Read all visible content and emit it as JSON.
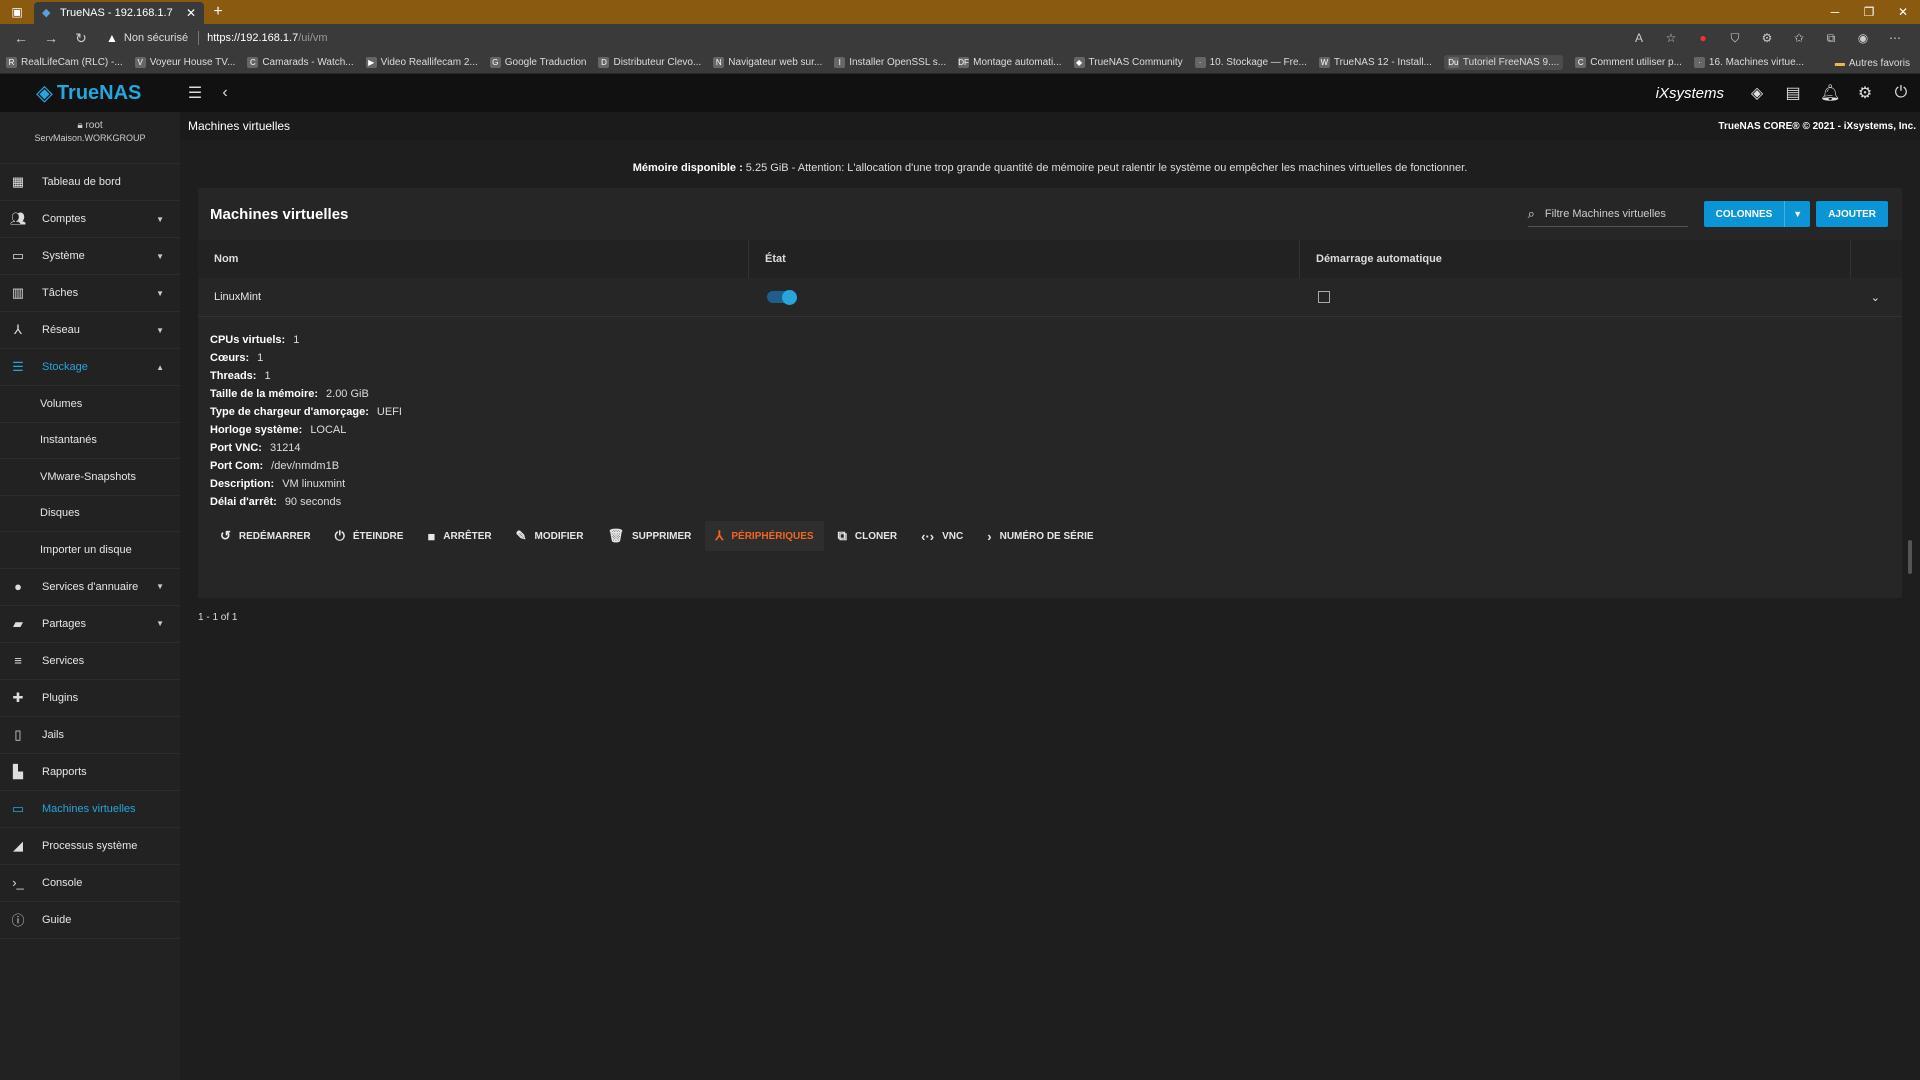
{
  "browser": {
    "tab_title": "TrueNAS - 192.168.1.7",
    "insecure_label": "Non sécurisé",
    "url_host": "https://192.168.1.7",
    "url_path": "/ui/vm",
    "bookmarks": [
      "RealLifeCam (RLC) -...",
      "Voyeur House TV...",
      "Camarads - Watch...",
      "Video Reallifecam 2...",
      "Google Traduction",
      "Distributeur Clevo...",
      "Navigateur web sur...",
      "Installer OpenSSL s...",
      "Montage automati...",
      "TrueNAS Community",
      "10. Stockage — Fre...",
      "TrueNAS 12 - Install...",
      "Tutoriel FreeNAS 9....",
      "Comment utiliser p...",
      "16. Machines virtue..."
    ],
    "other_bookmarks": "Autres favoris"
  },
  "app": {
    "logo": "TrueNAS",
    "vendor": "iXsystems",
    "copyright": "TrueNAS CORE® © 2021 - iXsystems, Inc."
  },
  "user": {
    "name": "root",
    "host": "ServMaison.WORKGROUP"
  },
  "sidebar": {
    "items": [
      {
        "label": "Tableau de bord"
      },
      {
        "label": "Comptes"
      },
      {
        "label": "Système"
      },
      {
        "label": "Tâches"
      },
      {
        "label": "Réseau"
      },
      {
        "label": "Stockage"
      },
      {
        "label": "Services d'annuaire"
      },
      {
        "label": "Partages"
      },
      {
        "label": "Services"
      },
      {
        "label": "Plugins"
      },
      {
        "label": "Jails"
      },
      {
        "label": "Rapports"
      },
      {
        "label": "Machines virtuelles"
      },
      {
        "label": "Processus système"
      },
      {
        "label": "Console"
      },
      {
        "label": "Guide"
      }
    ],
    "storage_sub": [
      "Volumes",
      "Instantanés",
      "VMware-Snapshots",
      "Disques",
      "Importer un disque"
    ]
  },
  "page": {
    "title": "Machines virtuelles",
    "memory_label": "Mémoire disponible :",
    "memory_text": " 5.25 GiB - Attention: L'allocation d'une trop grande quantité de mémoire peut ralentir le système ou empêcher les machines virtuelles de fonctionner."
  },
  "card": {
    "title": "Machines virtuelles",
    "filter_placeholder": "Filtre Machines virtuelles",
    "columns_button": "COLONNES",
    "add_button": "AJOUTER",
    "headers": [
      "Nom",
      "État",
      "Démarrage automatique"
    ]
  },
  "vm": {
    "name": "LinuxMint",
    "running": true,
    "autostart": false,
    "details": [
      {
        "key": "CPUs virtuels:",
        "value": "1"
      },
      {
        "key": "Cœurs:",
        "value": "1"
      },
      {
        "key": "Threads:",
        "value": "1"
      },
      {
        "key": "Taille de la mémoire:",
        "value": "2.00 GiB"
      },
      {
        "key": "Type de chargeur d'amorçage:",
        "value": "UEFI"
      },
      {
        "key": "Horloge système:",
        "value": "LOCAL"
      },
      {
        "key": "Port VNC:",
        "value": "31214"
      },
      {
        "key": "Port Com:",
        "value": "/dev/nmdm1B"
      },
      {
        "key": "Description:",
        "value": "VM linuxmint"
      },
      {
        "key": "Délai d'arrêt:",
        "value": "90 seconds"
      }
    ],
    "actions": [
      "REDÉMARRER",
      "ÉTEINDRE",
      "ARRÊTER",
      "MODIFIER",
      "SUPPRIMER",
      "PÉRIPHÉRIQUES",
      "CLONER",
      "VNC",
      "NUMÉRO DE SÉRIE"
    ]
  },
  "paginator": "1 - 1 of 1",
  "colors": {
    "accent": "#27a5dd",
    "button": "#0b95d6",
    "active_action": "#f26522"
  }
}
